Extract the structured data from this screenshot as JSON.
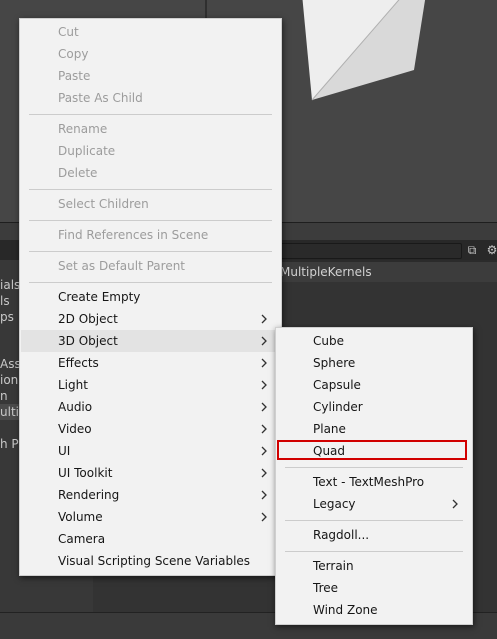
{
  "background": {
    "header_text": "MultipleKernels",
    "left_labels": [
      "ials",
      "ls",
      "ps",
      "Ass",
      "ion",
      "n",
      "ultip",
      "h Pr"
    ]
  },
  "context_menu": {
    "items": [
      {
        "label": "Cut",
        "enabled": false
      },
      {
        "label": "Copy",
        "enabled": false
      },
      {
        "label": "Paste",
        "enabled": false
      },
      {
        "label": "Paste As Child",
        "enabled": false
      },
      {
        "label": "Rename",
        "enabled": false
      },
      {
        "label": "Duplicate",
        "enabled": false
      },
      {
        "label": "Delete",
        "enabled": false
      },
      {
        "label": "Select Children",
        "enabled": false
      },
      {
        "label": "Find References in Scene",
        "enabled": false
      },
      {
        "label": "Set as Default Parent",
        "enabled": false
      },
      {
        "label": "Create Empty",
        "enabled": true
      },
      {
        "label": "2D Object",
        "enabled": true,
        "submenu": true
      },
      {
        "label": "3D Object",
        "enabled": true,
        "submenu": true,
        "open": true
      },
      {
        "label": "Effects",
        "enabled": true,
        "submenu": true
      },
      {
        "label": "Light",
        "enabled": true,
        "submenu": true
      },
      {
        "label": "Audio",
        "enabled": true,
        "submenu": true
      },
      {
        "label": "Video",
        "enabled": true,
        "submenu": true
      },
      {
        "label": "UI",
        "enabled": true,
        "submenu": true
      },
      {
        "label": "UI Toolkit",
        "enabled": true,
        "submenu": true
      },
      {
        "label": "Rendering",
        "enabled": true,
        "submenu": true
      },
      {
        "label": "Volume",
        "enabled": true,
        "submenu": true
      },
      {
        "label": "Camera",
        "enabled": true
      },
      {
        "label": "Visual Scripting Scene Variables",
        "enabled": true
      }
    ]
  },
  "submenu_3d_object": {
    "items": [
      {
        "label": "Cube"
      },
      {
        "label": "Sphere"
      },
      {
        "label": "Capsule"
      },
      {
        "label": "Cylinder"
      },
      {
        "label": "Plane"
      },
      {
        "label": "Quad",
        "highlighted": true
      },
      {
        "label": "Text - TextMeshPro"
      },
      {
        "label": "Legacy",
        "submenu": true
      },
      {
        "label": "Ragdoll..."
      },
      {
        "label": "Terrain"
      },
      {
        "label": "Tree"
      },
      {
        "label": "Wind Zone"
      }
    ]
  },
  "colors": {
    "highlight_border": "#d10000",
    "menu_background": "#f2f2f2",
    "disabled_text": "#9c9c9c"
  }
}
